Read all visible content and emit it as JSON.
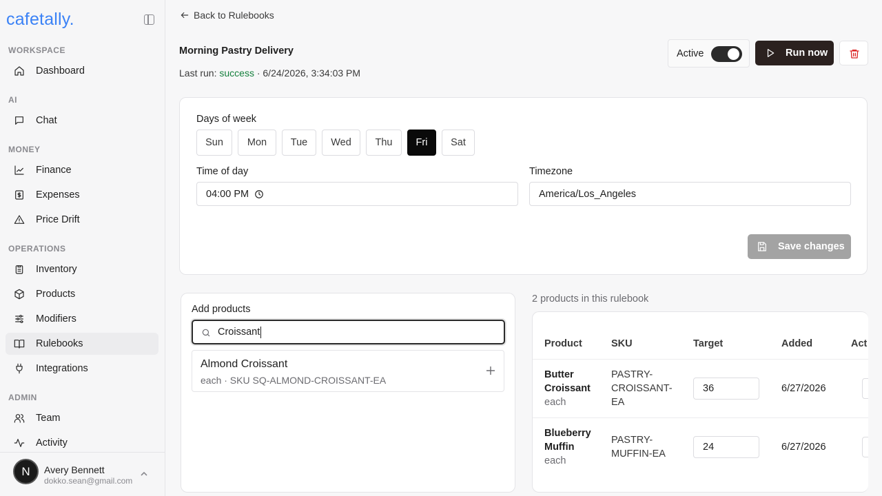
{
  "brand": {
    "logo": "cafetally."
  },
  "sidebar": {
    "sections": [
      {
        "label": "WORKSPACE"
      },
      {
        "label": "AI"
      },
      {
        "label": "MONEY"
      },
      {
        "label": "OPERATIONS"
      },
      {
        "label": "ADMIN"
      }
    ],
    "items": [
      {
        "label": "Dashboard",
        "icon": "home-icon"
      },
      {
        "label": "Chat",
        "icon": "chat-icon"
      },
      {
        "label": "Finance",
        "icon": "chart-line-icon"
      },
      {
        "label": "Expenses",
        "icon": "receipt-dollar-icon"
      },
      {
        "label": "Price Drift",
        "icon": "warning-triangle-icon"
      },
      {
        "label": "Inventory",
        "icon": "clipboard-icon"
      },
      {
        "label": "Products",
        "icon": "package-icon"
      },
      {
        "label": "Modifiers",
        "icon": "sliders-icon"
      },
      {
        "label": "Rulebooks",
        "icon": "book-icon"
      },
      {
        "label": "Integrations",
        "icon": "plug-icon"
      },
      {
        "label": "Team",
        "icon": "users-icon"
      },
      {
        "label": "Activity",
        "icon": "activity-icon"
      }
    ],
    "active_item": "Rulebooks",
    "user": {
      "initial": "N",
      "name": "Avery Bennett",
      "email": "dokko.sean@gmail.com"
    }
  },
  "header": {
    "back_label": "Back to Rulebooks",
    "title": "Morning Pastry Delivery",
    "last_run_prefix": "Last run: ",
    "last_run_status": "success",
    "last_run_time": " · 6/24/2026, 3:34:03 PM",
    "active_label": "Active",
    "active_on": true,
    "run_label": "Run now"
  },
  "schedule": {
    "days_label": "Days of week",
    "days": [
      "Sun",
      "Mon",
      "Tue",
      "Wed",
      "Thu",
      "Fri",
      "Sat"
    ],
    "selected_day": "Fri",
    "time_label": "Time of day",
    "time_value": "04:00 PM",
    "timezone_label": "Timezone",
    "timezone_value": "America/Los_Angeles",
    "save_label": "Save changes"
  },
  "add_products": {
    "label": "Add products",
    "search_value": "Croissant",
    "results": [
      {
        "name": "Almond Croissant",
        "meta": "each · SKU SQ-ALMOND-CROISSANT-EA"
      }
    ]
  },
  "rulebook_products": {
    "count_label": "2 products in this rulebook",
    "columns": [
      "Product",
      "SKU",
      "Target",
      "Added",
      "Act"
    ],
    "rows": [
      {
        "name_line1": "Butter",
        "name_line2": "Croissant",
        "unit": "each",
        "sku_lines": [
          "PASTRY-",
          "CROISSANT-",
          "EA"
        ],
        "target": "36",
        "added": "6/27/2026"
      },
      {
        "name_line1": "Blueberry",
        "name_line2": "Muffin",
        "unit": "each",
        "sku_lines": [
          "PASTRY-",
          "MUFFIN-EA"
        ],
        "target": "24",
        "added": "6/27/2026"
      }
    ]
  },
  "colors": {
    "brand": "#3b82f6",
    "success": "#15803d",
    "primary_button": "#2b211f",
    "delete": "#dc2626"
  }
}
